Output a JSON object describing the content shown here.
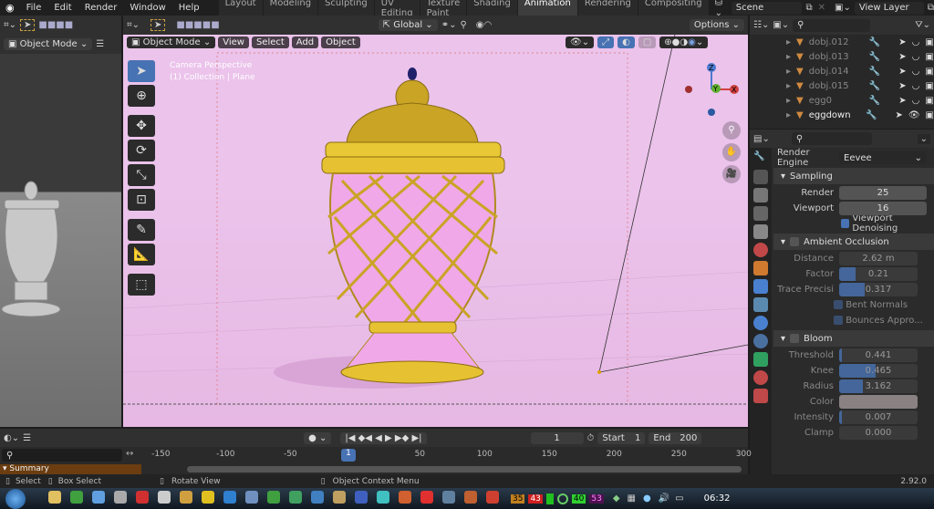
{
  "topbar": {
    "menu": [
      "File",
      "Edit",
      "Render",
      "Window",
      "Help"
    ],
    "workspaces": [
      "Layout",
      "Modeling",
      "Sculpting",
      "UV Editing",
      "Texture Paint",
      "Shading",
      "Animation",
      "Rendering",
      "Compositing"
    ],
    "active_workspace": "Animation",
    "scene": "Scene",
    "view_layer": "View Layer"
  },
  "left_editor": {
    "mode": "Object Mode"
  },
  "viewport": {
    "mode": "Object Mode",
    "menus": [
      "View",
      "Select",
      "Add",
      "Object"
    ],
    "orientation": "Global",
    "options": "Options",
    "overlay_line1": "Camera Perspective",
    "overlay_line2": "(1) Collection | Plane",
    "gizmo": {
      "x": "X",
      "y": "Y",
      "z": "Z"
    },
    "background": "#ebc3eb"
  },
  "outliner": {
    "items": [
      {
        "name": "dobj.012",
        "visible": false
      },
      {
        "name": "dobj.013",
        "visible": false
      },
      {
        "name": "dobj.014",
        "visible": false
      },
      {
        "name": "dobj.015",
        "visible": false
      },
      {
        "name": "egg0",
        "visible": false
      },
      {
        "name": "eggdown",
        "visible": true
      }
    ]
  },
  "properties": {
    "render_engine_label": "Render Engine",
    "render_engine": "Eevee",
    "sampling": {
      "title": "Sampling",
      "render_label": "Render",
      "render": "25",
      "viewport_label": "Viewport",
      "viewport": "16",
      "denoise": "Viewport Denoising"
    },
    "ao": {
      "title": "Ambient Occlusion",
      "distance_label": "Distance",
      "distance": "2.62 m",
      "factor_label": "Factor",
      "factor": "0.21",
      "trace_label": "Trace Precisi",
      "trace": "0.317",
      "bent": "Bent Normals",
      "bounces": "Bounces Appro..."
    },
    "bloom": {
      "title": "Bloom",
      "threshold_label": "Threshold",
      "threshold": "0.441",
      "knee_label": "Knee",
      "knee": "0.465",
      "radius_label": "Radius",
      "radius": "3.162",
      "color_label": "Color",
      "intensity_label": "Intensity",
      "intensity": "0.007",
      "clamp_label": "Clamp",
      "clamp": "0.000"
    }
  },
  "timeline": {
    "current_frame": "1",
    "start_label": "Start",
    "start": "1",
    "end_label": "End",
    "end": "200",
    "ticks": [
      "-150",
      "-100",
      "-50",
      "50",
      "100",
      "150",
      "200",
      "250",
      "300"
    ],
    "playhead": "1",
    "summary": "Summary"
  },
  "statusbar": {
    "select": "Select",
    "box_select": "Box Select",
    "rotate": "Rotate View",
    "context": "Object Context Menu",
    "version": "2.92.0"
  },
  "taskbar": {
    "badges": [
      "35",
      "43",
      "40",
      "53"
    ],
    "clock": "06:32"
  }
}
